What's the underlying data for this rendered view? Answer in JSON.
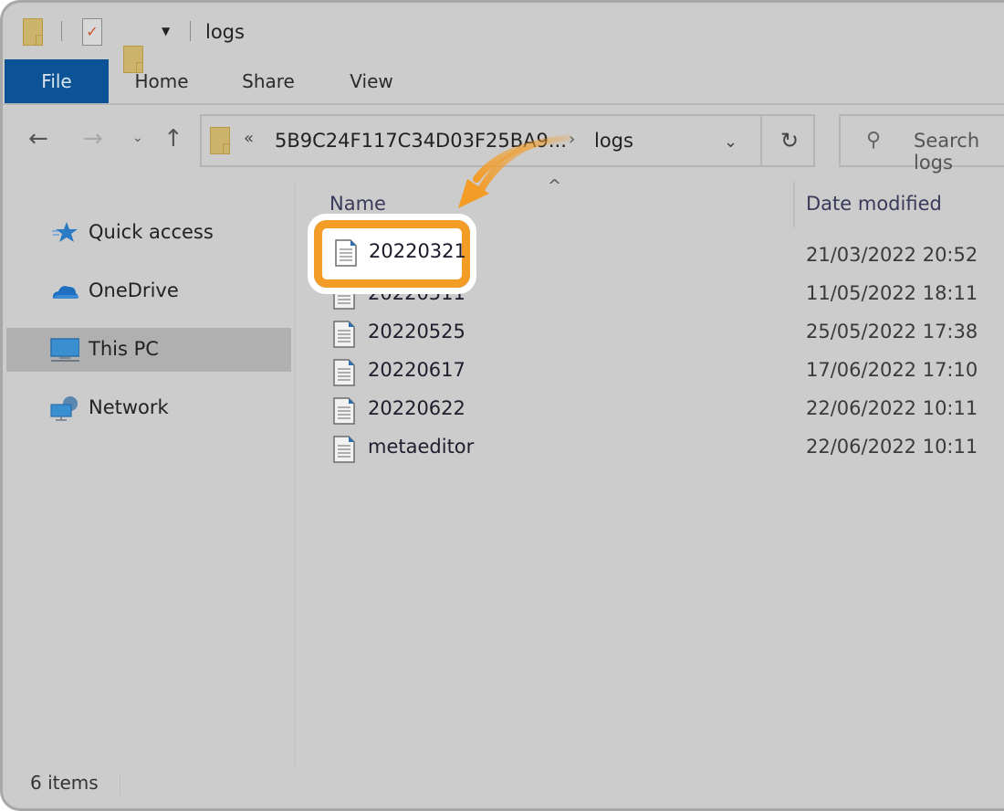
{
  "window": {
    "title": "logs"
  },
  "ribbon": {
    "tabs": [
      {
        "label": "File",
        "active": true
      },
      {
        "label": "Home"
      },
      {
        "label": "Share"
      },
      {
        "label": "View"
      }
    ],
    "file_color": "#0b5394"
  },
  "navigation": {
    "back_icon": "arrow-left-icon",
    "forward_icon": "arrow-right-icon",
    "recent_icon": "chevron-down-icon",
    "up_icon": "arrow-up-icon"
  },
  "address_bar": {
    "overflow_glyph": "«",
    "path_segment": "5B9C24F117C34D03F25BA9...",
    "separator": "›",
    "current": "logs",
    "refresh_glyph": "↻"
  },
  "search": {
    "placeholder": "Search logs"
  },
  "sidebar": {
    "items": [
      {
        "label": "Quick access",
        "icon": "quick-access-star-icon"
      },
      {
        "label": "OneDrive",
        "icon": "onedrive-cloud-icon"
      },
      {
        "label": "This PC",
        "icon": "this-pc-monitor-icon",
        "selected": true
      },
      {
        "label": "Network",
        "icon": "network-icon"
      }
    ]
  },
  "file_list": {
    "columns": {
      "name": "Name",
      "date_modified": "Date modified"
    },
    "rows": [
      {
        "name": "20220321",
        "date": "21/03/2022 20:52",
        "highlighted": true
      },
      {
        "name": "20220511",
        "date": "11/05/2022 18:11"
      },
      {
        "name": "20220525",
        "date": "25/05/2022 17:38"
      },
      {
        "name": "20220617",
        "date": "17/06/2022 17:10"
      },
      {
        "name": "20220622",
        "date": "22/06/2022 10:11"
      },
      {
        "name": "metaeditor",
        "date": "22/06/2022 10:11"
      }
    ]
  },
  "status_bar": {
    "item_count": "6 items"
  },
  "annotation": {
    "callout_color": "#f39c26",
    "target": "20220321"
  }
}
